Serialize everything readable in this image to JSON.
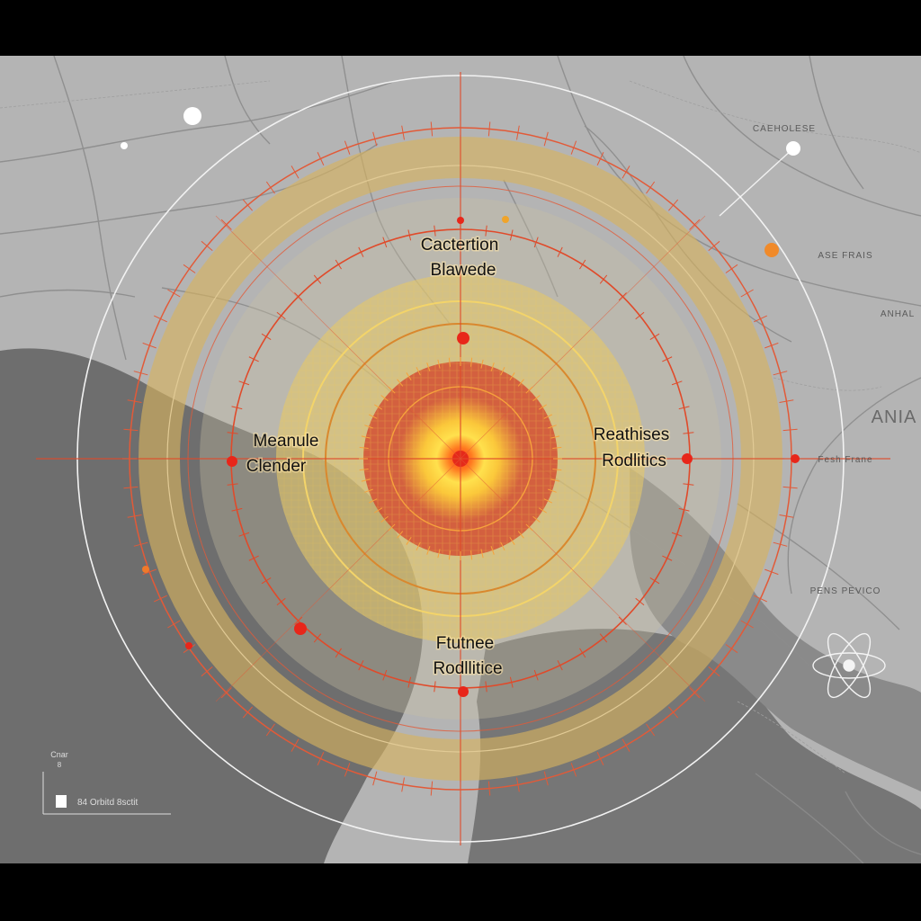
{
  "map": {
    "zone_labels": [
      {
        "line1": "Cactertion",
        "line2": "Blawede"
      },
      {
        "line1": "Meanule",
        "line2": "Clender"
      },
      {
        "line1": "Reathises",
        "line2": "Rodlitics"
      },
      {
        "line1": "Ftutnee",
        "line2": "Rodllitice"
      }
    ],
    "place_labels": [
      "ASE FRAIS",
      "ANHAL",
      "ANIA",
      "Fesh Frane",
      "PENS PEVICO",
      "CAEHOLESE"
    ],
    "legend": {
      "title": "Cnar",
      "subtitle": "8",
      "scale_text": "84 Orbitd 8sctit"
    },
    "icons": [
      "atom-icon",
      "compass-marker-icon"
    ],
    "colors": {
      "land_light": "#b7b7b7",
      "water_dark": "#707070",
      "ring_orange": "#e0462a",
      "zone_gold": "#d9b760",
      "core_yellow": "#ffe14d"
    }
  }
}
